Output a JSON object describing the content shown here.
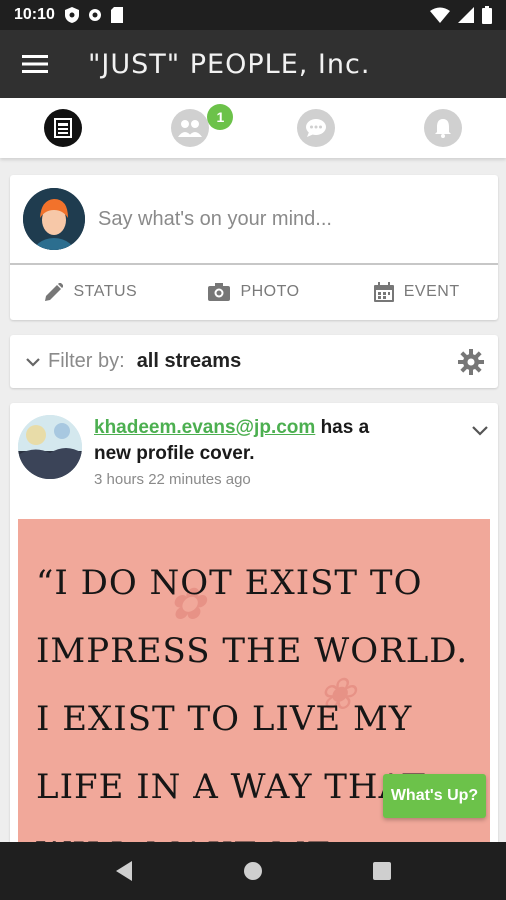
{
  "status_bar": {
    "time": "10:10"
  },
  "app": {
    "title": "\"JUST\" PEOPLE, Inc."
  },
  "tabs": [
    {
      "name": "newsfeed",
      "badge": ""
    },
    {
      "name": "people",
      "badge": "1"
    },
    {
      "name": "messages",
      "badge": ""
    },
    {
      "name": "notifications",
      "badge": ""
    }
  ],
  "composer": {
    "placeholder": "Say what's on your mind...",
    "actions": {
      "status": "STATUS",
      "photo": "PHOTO",
      "event": "EVENT"
    }
  },
  "filter": {
    "label": "Filter by:",
    "value": "all streams"
  },
  "post": {
    "username": "khadeem.evans@jp.com",
    "action_line_1": " has a",
    "action_line_2": "new profile cover.",
    "timestamp": "3 hours 22 minutes ago",
    "quote_text": "“I DO NOT EXIST TO IMPRESS THE WORLD. I EXIST TO LIVE MY LIFE IN A WAY THAT WILL MAKE ME"
  },
  "fab": {
    "label": "What's Up?"
  },
  "colors": {
    "accent": "#6cc24a",
    "appbar": "#303030",
    "quote_bg": "#f1a89a"
  }
}
